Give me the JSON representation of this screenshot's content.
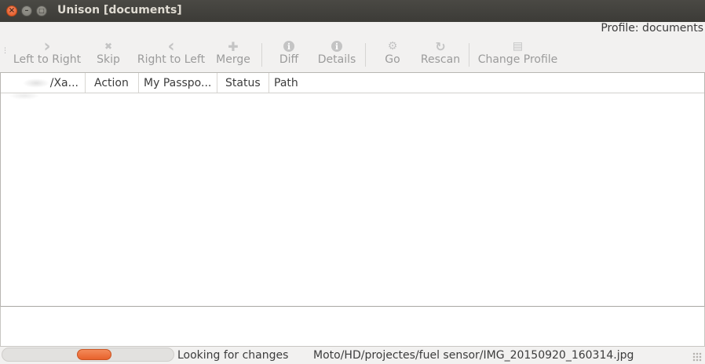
{
  "window": {
    "title": "Unison [documents]",
    "close_glyph": "×",
    "min_glyph": "–",
    "max_glyph": "□"
  },
  "profile_label": "Profile: documents",
  "toolbar": {
    "left_to_right": {
      "label": "Left to Right",
      "icon": "chevron-right-icon",
      "glyph": "›"
    },
    "skip": {
      "label": "Skip",
      "icon": "close-x-icon",
      "glyph": "✖"
    },
    "right_to_left": {
      "label": "Right to Left",
      "icon": "chevron-left-icon",
      "glyph": "‹"
    },
    "merge": {
      "label": "Merge",
      "icon": "plus-icon",
      "glyph": "✚"
    },
    "diff": {
      "label": "Diff",
      "icon": "info-icon",
      "glyph": "ℹ"
    },
    "details": {
      "label": "Details",
      "icon": "info-icon",
      "glyph": "ℹ"
    },
    "go": {
      "label": "Go",
      "icon": "execute-icon",
      "glyph": "⚙"
    },
    "rescan": {
      "label": "Rescan",
      "icon": "refresh-icon",
      "glyph": "↻"
    },
    "change_profile": {
      "label": "Change Profile",
      "icon": "document-icon",
      "glyph": "▤"
    }
  },
  "table": {
    "columns": [
      "/Xa...",
      "Action",
      "My Passpo...",
      "Status",
      "Path"
    ],
    "rows": []
  },
  "statusbar": {
    "progress_state": "pulsing",
    "message": "Looking for changes",
    "current_path": "Moto/HD/projectes/fuel sensor/IMG_20150920_160314.jpg"
  },
  "colors": {
    "titlebar": "#3c3b37",
    "close_button": "#e0531f",
    "progress_pulse": "#e8622c",
    "disabled_text": "#9b9b9b"
  }
}
